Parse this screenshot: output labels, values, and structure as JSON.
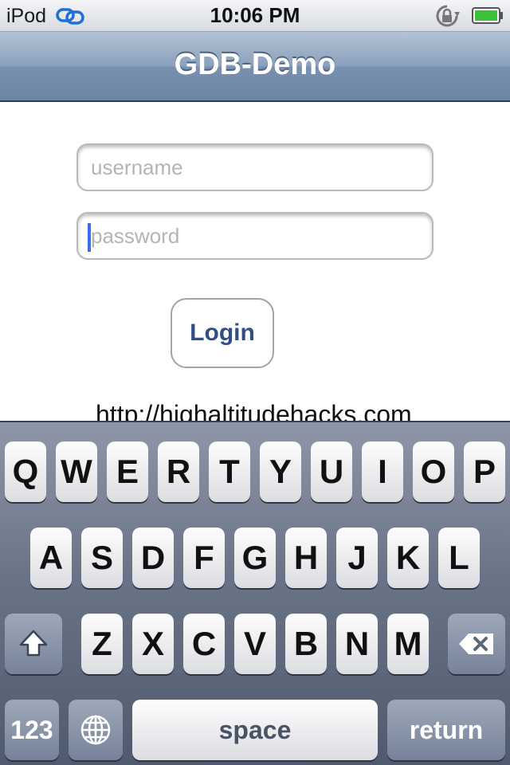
{
  "status_bar": {
    "carrier": "iPod",
    "time": "10:06 PM",
    "icons": [
      "sync-icon",
      "rotation-lock-icon",
      "battery-icon"
    ]
  },
  "nav": {
    "title": "GDB-Demo"
  },
  "form": {
    "username_placeholder": "username",
    "password_placeholder": "password",
    "login_label": "Login",
    "url": "http://highaltitudehacks.com"
  },
  "keyboard": {
    "row1": [
      "Q",
      "W",
      "E",
      "R",
      "T",
      "Y",
      "U",
      "I",
      "O",
      "P"
    ],
    "row2": [
      "A",
      "S",
      "D",
      "F",
      "G",
      "H",
      "J",
      "K",
      "L"
    ],
    "row3": [
      "Z",
      "X",
      "C",
      "V",
      "B",
      "N",
      "M"
    ],
    "numbers_label": "123",
    "space_label": "space",
    "return_label": "return"
  },
  "colors": {
    "nav_bar": "#7990af",
    "button_text": "#324f85",
    "caret": "#3e6cf0"
  }
}
